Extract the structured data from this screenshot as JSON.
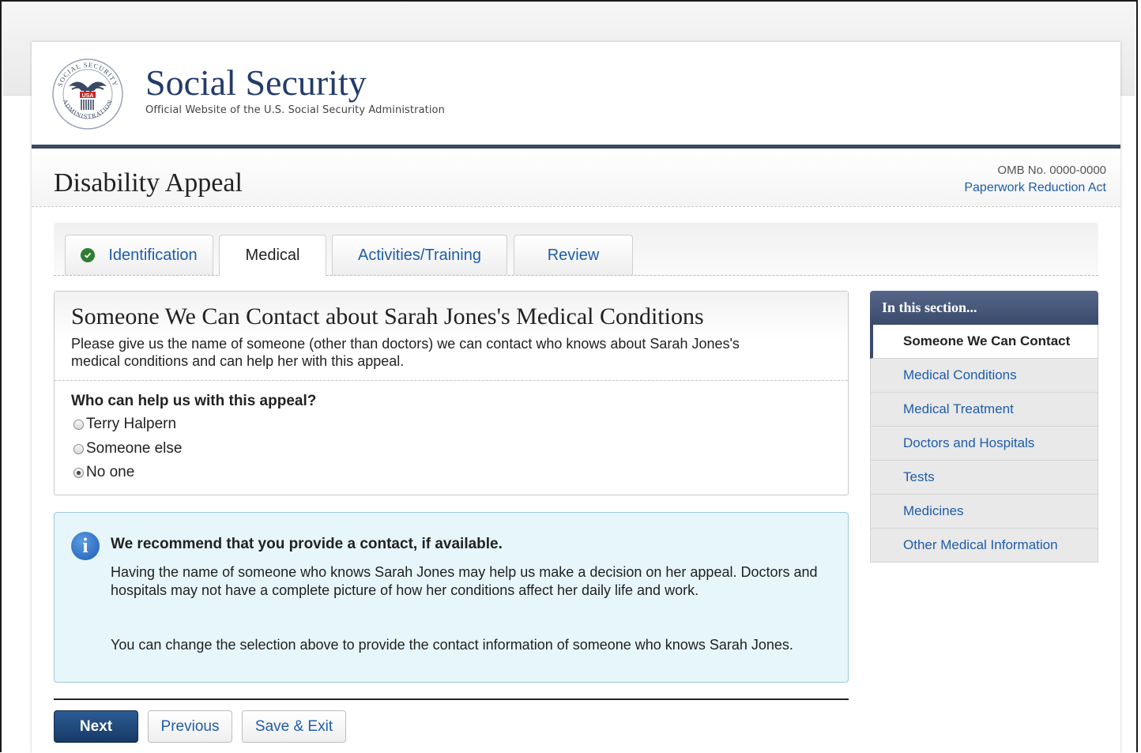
{
  "brand": {
    "title": "Social Security",
    "subtitle": "Official Website of the U.S. Social Security Administration",
    "seal_text_top": "SOCIAL SECURITY",
    "seal_text_bottom": "ADMINISTRATION",
    "seal_usa": "USA"
  },
  "titlebar": {
    "title": "Disability Appeal",
    "omb": "OMB No. 0000-0000",
    "pra_link": "Paperwork Reduction Act"
  },
  "tabs": [
    {
      "label": "Identification",
      "state": "completed"
    },
    {
      "label": "Medical",
      "state": "active"
    },
    {
      "label": "Activities/Training",
      "state": "default"
    },
    {
      "label": "Review",
      "state": "default"
    }
  ],
  "card": {
    "title": "Someone We Can Contact about Sarah Jones's Medical Conditions",
    "description": "Please give us the name of someone (other than doctors) we can contact who knows about Sarah Jones's medical conditions and can help her with this appeal.",
    "question": "Who can help us with this appeal?",
    "options": [
      {
        "label": "Terry Halpern",
        "checked": false
      },
      {
        "label": "Someone else",
        "checked": false
      },
      {
        "label": "No one",
        "checked": true
      }
    ]
  },
  "info": {
    "icon": "info-icon",
    "title": "We recommend that you provide a contact, if available.",
    "paragraph1": "Having the name of someone who knows Sarah Jones may help us make a decision on her appeal. Doctors and hospitals may not have a complete picture of how her conditions affect her daily life and work.",
    "paragraph2": "You can change the selection above to provide the contact information of someone who knows Sarah Jones."
  },
  "buttons": {
    "next": "Next",
    "previous": "Previous",
    "save_exit": "Save & Exit"
  },
  "sidebar": {
    "heading": "In this section...",
    "items": [
      {
        "label": "Someone We Can Contact",
        "current": true
      },
      {
        "label": "Medical Conditions",
        "current": false
      },
      {
        "label": "Medical Treatment",
        "current": false
      },
      {
        "label": "Doctors and Hospitals",
        "current": false
      },
      {
        "label": "Tests",
        "current": false
      },
      {
        "label": "Medicines",
        "current": false
      },
      {
        "label": "Other Medical Information",
        "current": false
      }
    ]
  },
  "colors": {
    "navy": "#243b6b",
    "link": "#1f5da8",
    "check_green": "#2e7d32",
    "info_bg": "#e6f6fa"
  }
}
